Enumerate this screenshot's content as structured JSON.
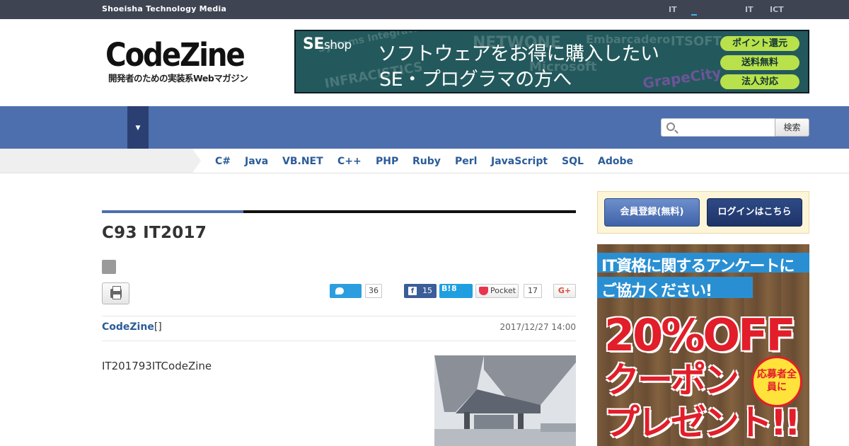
{
  "topbar": {
    "brand": "Shoeisha Technology Media",
    "links": [
      "IT",
      "IT",
      "ICT"
    ]
  },
  "logo": {
    "name": "CodeZine",
    "tagline": "開発者のための実装系Webマガジン"
  },
  "banner": {
    "shop": "SE",
    "shop_suffix": "shop",
    "headline1": "ソフトウェアをお得に購入したい",
    "headline2": "SE・プログラマの方へ",
    "pills": [
      "ポイント還元",
      "送料無料",
      "法人対応"
    ],
    "bg_words": [
      "Systems Integrator",
      "INFRACISTICS",
      "NETWONE",
      "Embarcadero",
      "Microsoft",
      "GrapeCity",
      "ITSOFT"
    ]
  },
  "nav": {
    "dropdown_arrow": "▼"
  },
  "search": {
    "placeholder": "",
    "button_label": "検索"
  },
  "languages": [
    "C#",
    "Java",
    "VB.NET",
    "C++",
    "PHP",
    "Ruby",
    "Perl",
    "JavaScript",
    "SQL",
    "Adobe"
  ],
  "article": {
    "title": "C93 IT2017",
    "author_link": "CodeZine",
    "author_suffix": "[]",
    "date": "2017/12/27 14:00",
    "lead": "IT201793ITCodeZine"
  },
  "social": {
    "twitter_count": "36",
    "facebook_count": "15",
    "hatena_label": "B!",
    "hatena_count": "8",
    "pocket_label": "Pocket",
    "pocket_count": "17",
    "gplus_label": "G+"
  },
  "sidebar": {
    "register_label": "会員登録(無料)",
    "login_label": "ログインはこちら",
    "ad": {
      "line1": "IT資格に関するアンケートに",
      "line2": "ご協力ください!",
      "offer": "20%OFF",
      "coupon": "クーポン",
      "present": "プレゼント!!",
      "seal": "応募者全員に"
    }
  },
  "colors": {
    "topbar": "#3e4452",
    "nav_blue": "#4e6fad",
    "link_blue": "#2b5c99",
    "accent_red": "#e21e2a"
  }
}
